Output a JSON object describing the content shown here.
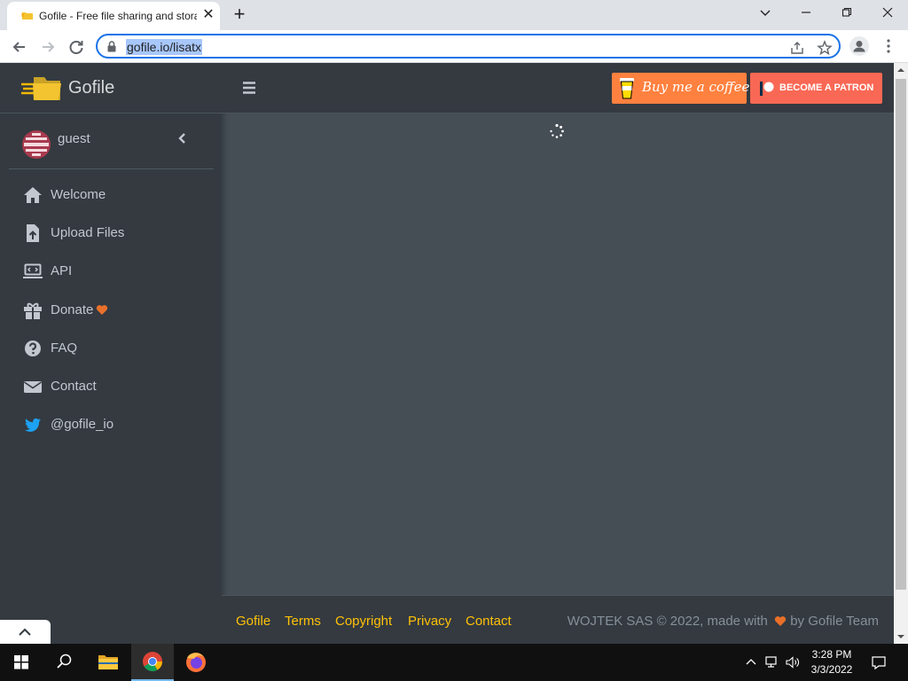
{
  "browser": {
    "tab_title": "Gofile - Free file sharing and storage",
    "url": "gofile.io/lisatx"
  },
  "sidebar": {
    "brand": "Gofile",
    "user": "guest",
    "items": [
      {
        "label": "Welcome",
        "icon": "home-icon"
      },
      {
        "label": "Upload Files",
        "icon": "file-upload-icon"
      },
      {
        "label": "API",
        "icon": "laptop-code-icon"
      },
      {
        "label": "Donate",
        "icon": "gift-icon"
      },
      {
        "label": "FAQ",
        "icon": "question-circle-icon"
      },
      {
        "label": "Contact",
        "icon": "envelope-icon"
      },
      {
        "label": "@gofile_io",
        "icon": "twitter-icon"
      }
    ]
  },
  "header": {
    "buy_coffee": "Buy me a coffee",
    "become_patron": "BECOME A PATRON"
  },
  "footer": {
    "links": [
      "Gofile",
      "Terms",
      "Copyright",
      "Privacy",
      "Contact"
    ],
    "copyright_prefix": "WOJTEK SAS © 2022, made with",
    "copyright_suffix": "by Gofile Team"
  },
  "taskbar": {
    "time": "3:28 PM",
    "date": "3/3/2022"
  },
  "colors": {
    "accent_link": "#ffc107",
    "heart": "#e8702a",
    "bmc": "#ff813f",
    "patreon": "#f96854"
  }
}
